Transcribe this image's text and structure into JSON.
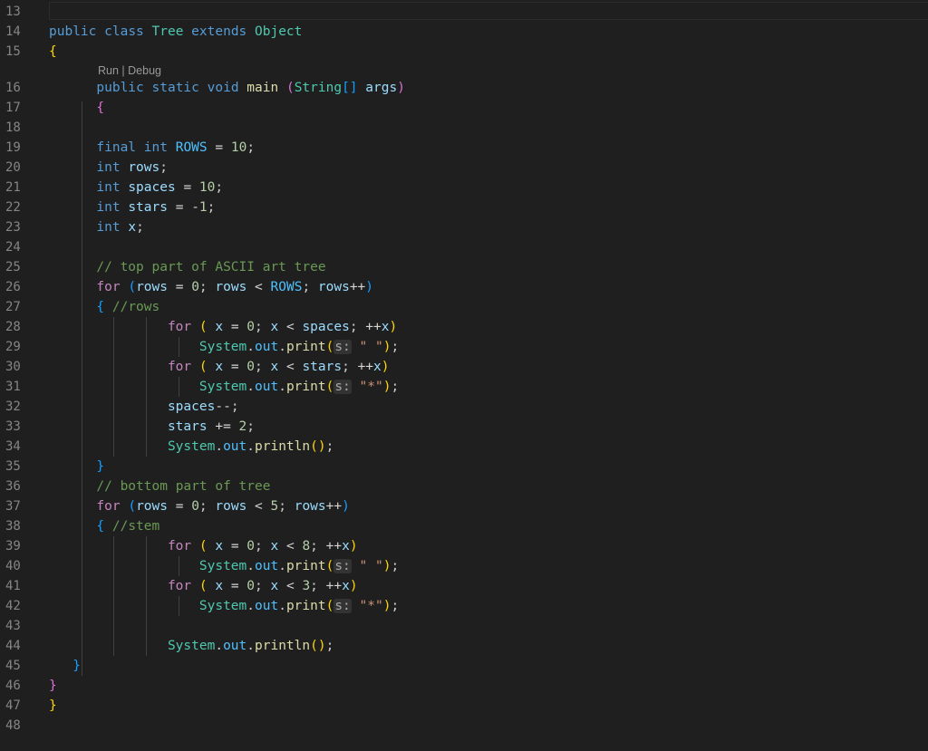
{
  "gutter": {
    "line_numbers": [
      "13",
      "14",
      "15",
      "16",
      "17",
      "18",
      "19",
      "20",
      "21",
      "22",
      "23",
      "24",
      "25",
      "26",
      "27",
      "28",
      "29",
      "30",
      "31",
      "32",
      "33",
      "34",
      "35",
      "36",
      "37",
      "38",
      "39",
      "40",
      "41",
      "42",
      "43",
      "44",
      "45",
      "46",
      "47",
      "48"
    ]
  },
  "codelens": {
    "run": "Run",
    "separator": " | ",
    "debug": "Debug"
  },
  "code": {
    "line14": "public class Tree extends Object",
    "line15": "{",
    "line16": "public static void main (String[] args)",
    "line17": "{",
    "line19": "final int ROWS = 10;",
    "line20": "int rows;",
    "line21": "int spaces = 10;",
    "line22": "int stars = -1;",
    "line23": "int x;",
    "line25": "// top part of ASCII art tree",
    "line26": "for (rows = 0; rows < ROWS; rows++)",
    "line27": "{ //rows",
    "line28": "for ( x = 0; x < spaces; ++x)",
    "line29": "System.out.print(s: \" \");",
    "line30": "for ( x = 0; x < stars; ++x)",
    "line31": "System.out.print(s: \"*\");",
    "line32": "spaces--;",
    "line33": "stars += 2;",
    "line34": "System.out.println();",
    "line35": "}",
    "line36": "// bottom part of tree",
    "line37": "for (rows = 0; rows < 5; rows++)",
    "line38": "{ //stem",
    "line39": "for ( x = 0; x < 8; ++x)",
    "line40": "System.out.print(s: \" \");",
    "line41": "for ( x = 0; x < 3; ++x)",
    "line42": "System.out.print(s: \"*\");",
    "line44": "System.out.println();",
    "line45": "}",
    "line46": "}",
    "line47": "}"
  },
  "colors": {
    "background": "#1f1f1f",
    "line_number": "#858585",
    "keyword": "#569cd6",
    "control": "#c586c0",
    "type": "#4ec9b0",
    "variable": "#9cdcfe",
    "constant": "#4fc1ff",
    "number": "#b5cea8",
    "string": "#ce9178",
    "function": "#dcdcaa",
    "comment": "#6a9955",
    "bracket_level1": "#ffd700",
    "bracket_level2": "#da70d6",
    "bracket_level3": "#179fff"
  }
}
